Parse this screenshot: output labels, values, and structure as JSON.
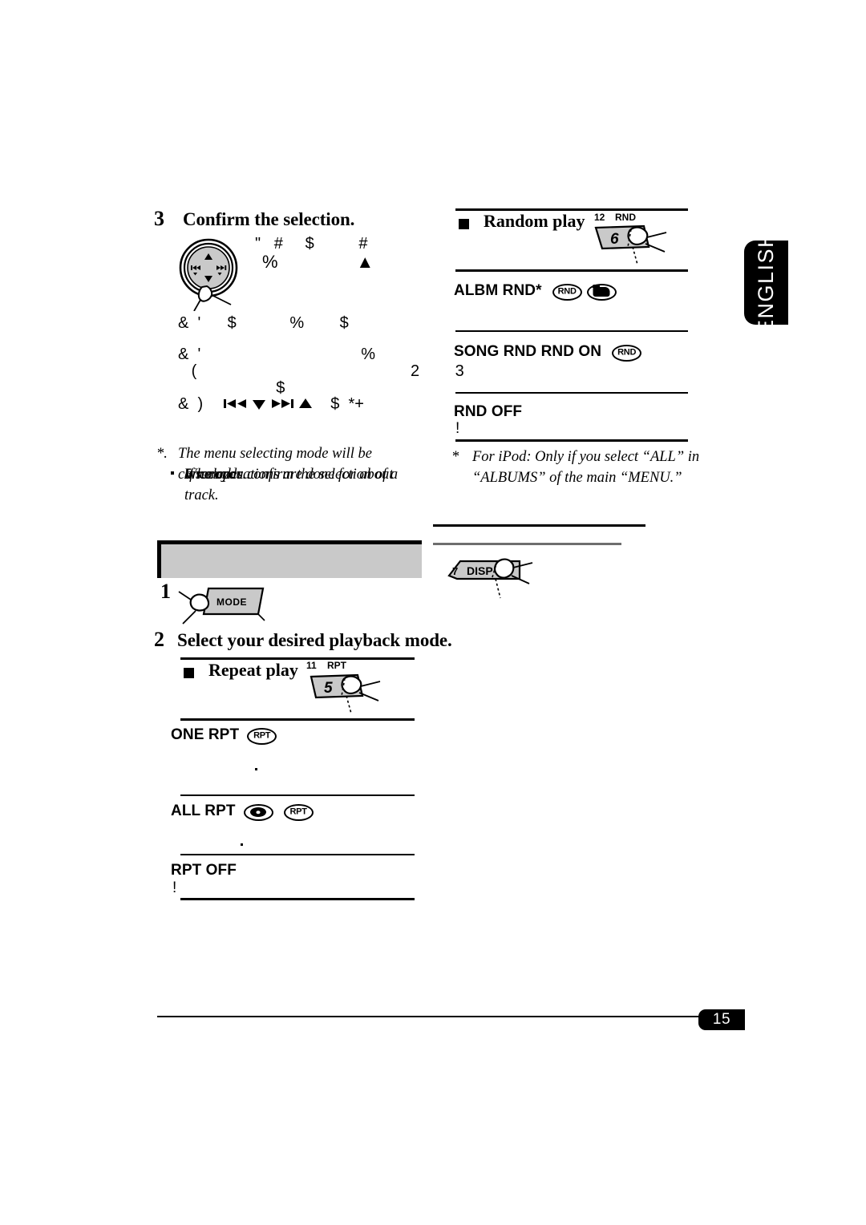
{
  "meta": {
    "page_number": "15",
    "language_tab": "ENGLISH"
  },
  "left_column": {
    "step3": {
      "number": "3",
      "heading": "Confirm the selection.",
      "glyph_lines": [
        "\"   #     $          #",
        "%                ▲",
        "&  '      $            %        $",
        "&  '                                    %",
        "   (                                                2        3",
        "                      $",
        "&  )        ?? ?  ?? ?       $   *+"
      ],
      "pad_icon": "control-pad-icon"
    },
    "footnote": {
      "marker": "*.",
      "line1": "The menu selecting mode will be canceled:",
      "bullets": [
        "If no operations are done for about",
        "5 seconds.",
        "When you confirm the selection of a track."
      ]
    },
    "gray_band": {
      "title": ""
    },
    "step1": {
      "number": "1",
      "button_label": "MODE"
    },
    "step2": {
      "number": "2",
      "heading": "Select your desired playback mode."
    },
    "repeat_section": {
      "heading": "Repeat play",
      "button": {
        "preset_number": "11",
        "indicator": "RPT",
        "key_label": "5"
      },
      "modes": [
        {
          "label": "ONE RPT",
          "badges": [
            "RPT"
          ],
          "suffix": ""
        },
        {
          "label": "ALL RPT",
          "badges": [
            "DISC",
            "RPT"
          ],
          "suffix": ""
        },
        {
          "label": "RPT OFF",
          "badges": [],
          "suffix": "!"
        }
      ]
    }
  },
  "right_column": {
    "random_section": {
      "heading": "Random play",
      "button": {
        "preset_number": "12",
        "indicator": "RND",
        "key_label": "6"
      },
      "modes": [
        {
          "label": "ALBM RND*",
          "badges": [
            "RND",
            "FOLDER"
          ],
          "suffix": ""
        },
        {
          "label": "SONG RND  RND ON",
          "badges": [
            "RND"
          ],
          "suffix": ""
        },
        {
          "label": "RND OFF",
          "badges": [],
          "suffix": "!"
        }
      ]
    },
    "footnote": {
      "marker": "*",
      "line1": "For iPod: Only if you select “ALL” in",
      "line2": "“ALBUMS” of the main “MENU.”"
    },
    "disp_button": {
      "preset_number": "7",
      "key_label": "DISP"
    }
  },
  "colors": {
    "ink": "#000000",
    "gray_band": "#c9c9c9",
    "button_gray": "#c9c9c9",
    "rule_gray": "#6e6e6e"
  }
}
